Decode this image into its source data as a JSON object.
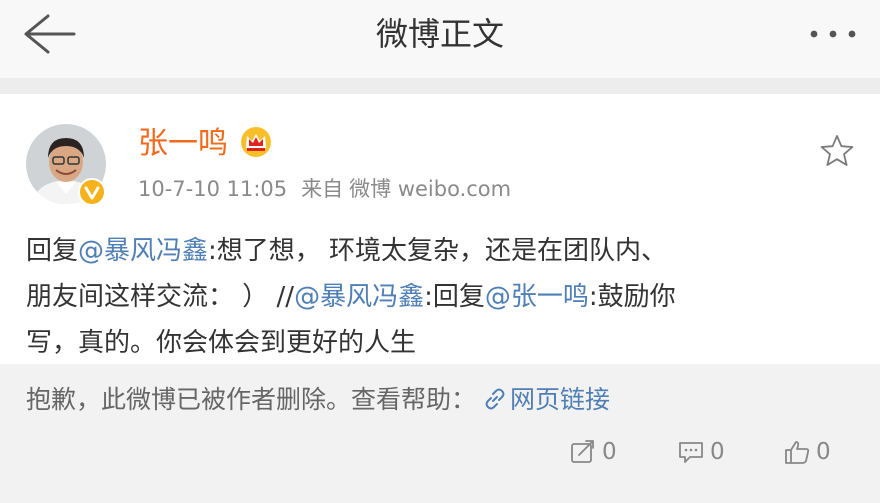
{
  "nav": {
    "title": "微博正文"
  },
  "post": {
    "user": {
      "name": "张一鸣"
    },
    "time": "10-7-10 11:05",
    "source_prefix": "来自",
    "source_name": "微博 weibo.com",
    "lines": [
      [
        {
          "t": "text",
          "v": "回复"
        },
        {
          "t": "mention",
          "v": "@暴风冯鑫"
        },
        {
          "t": "text",
          "v": ":想了想，  环境太复杂，还是在团队内、"
        }
      ],
      [
        {
          "t": "text",
          "v": "朋友间这样交流：  ）  //"
        },
        {
          "t": "mention",
          "v": "@暴风冯鑫"
        },
        {
          "t": "text",
          "v": ":回复"
        },
        {
          "t": "mention",
          "v": "@张一鸣"
        },
        {
          "t": "text",
          "v": ":鼓励你"
        }
      ],
      [
        {
          "t": "text",
          "v": "写，真的。你会体会到更好的人生"
        }
      ]
    ]
  },
  "footer": {
    "deleted_text": "抱歉，此微博已被作者删除。查看帮助：",
    "link_label": "网页链接"
  },
  "actions": {
    "repost_count": "0",
    "comment_count": "0",
    "like_count": "0"
  },
  "icons": {
    "back": "back-arrow-icon",
    "more": "more-dots-icon",
    "crown": "crown-icon",
    "verified": "verified-badge-icon",
    "star": "star-outline-icon",
    "link": "link-icon",
    "repost": "repost-icon",
    "comment": "comment-icon",
    "like": "like-icon"
  },
  "colors": {
    "username": "#f26a1b",
    "mention": "#4f7fb5",
    "meta": "#8a8a8a",
    "background_gray": "#f2f2f2"
  }
}
